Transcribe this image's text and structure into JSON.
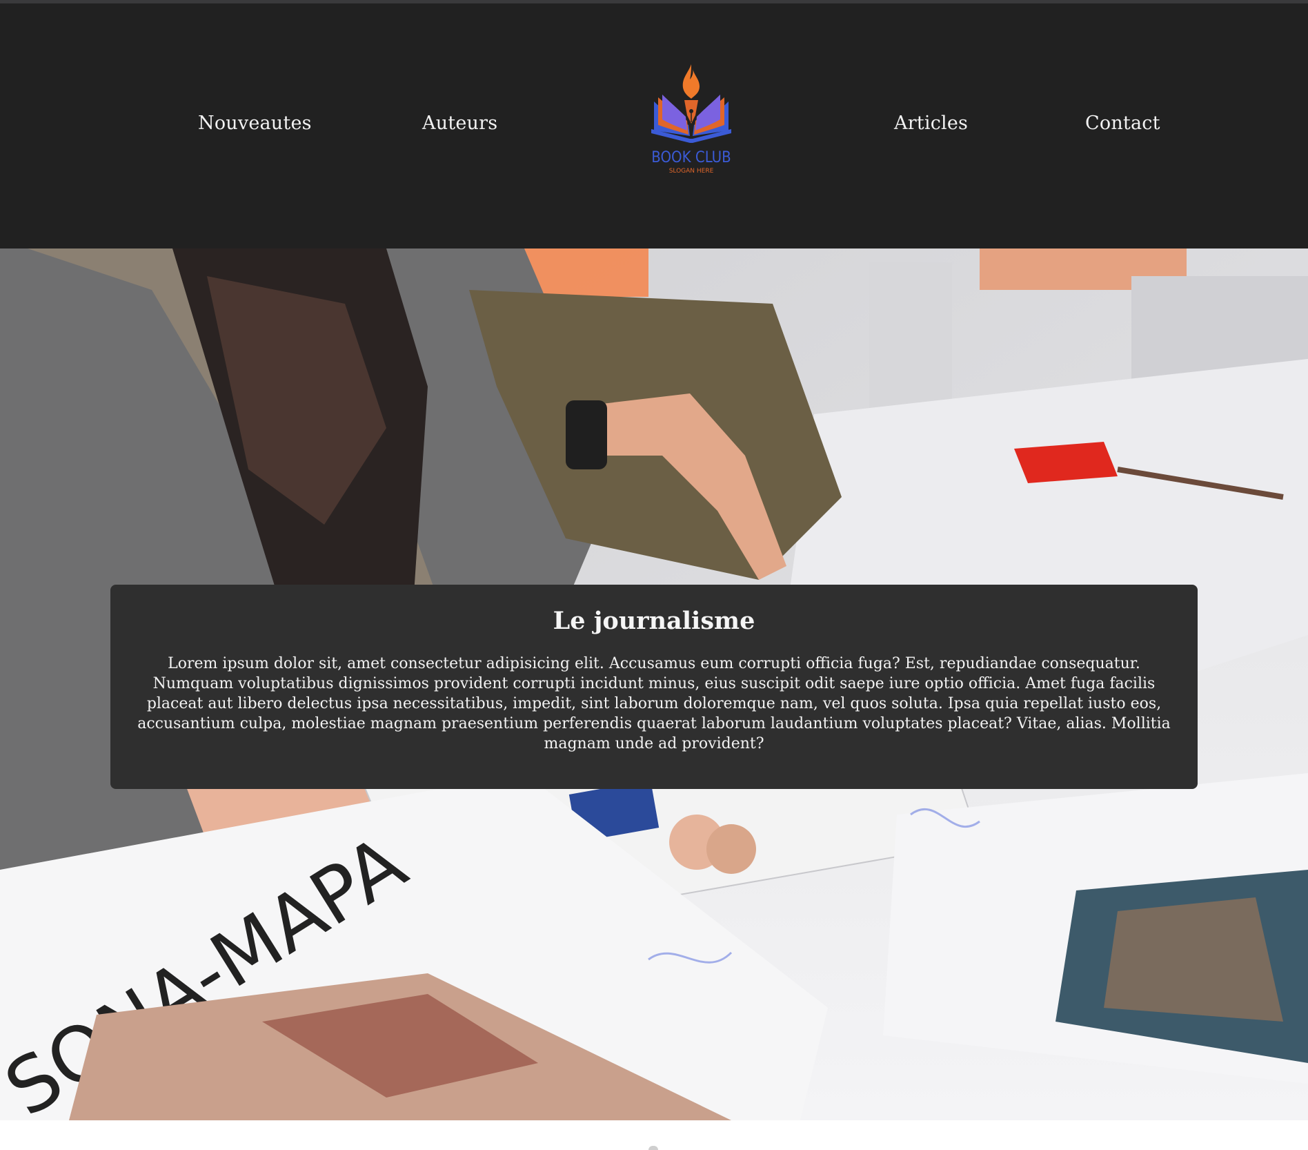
{
  "nav": {
    "items": [
      {
        "label": "Nouveautes"
      },
      {
        "label": "Auteurs"
      },
      {
        "label": "Articles"
      },
      {
        "label": "Contact"
      }
    ]
  },
  "logo": {
    "name": "BOOK CLUB",
    "slogan": "SLOGAN HERE",
    "icon": "book-pen-flame-logo"
  },
  "hero": {
    "image": "person-reading-magazines-photo",
    "image_text": "SONA-MAPA"
  },
  "card": {
    "title": "Le journalisme",
    "body": "Lorem ipsum dolor sit, amet consectetur adipisicing elit. Accusamus eum corrupti officia fuga? Est, repudiandae consequatur. Numquam voluptatibus dignissimos provident corrupti incidunt minus, eius suscipit odit saepe iure optio officia. Amet fuga facilis placeat aut libero delectus ipsa necessitatibus, impedit, sint laborum doloremque nam, vel quos soluta. Ipsa quia repellat iusto eos, accusantium culpa, molestiae magnam praesentium perferendis quaerat laborum laudantium voluptates placeat? Vitae, alias. Mollitia magnam unde ad provident?"
  },
  "colors": {
    "header_bg": "#212121",
    "card_bg": "#2f2f2f",
    "logo_orange": "#f07a2a",
    "logo_blue": "#3b5bd6",
    "text": "#f2f2f2"
  }
}
